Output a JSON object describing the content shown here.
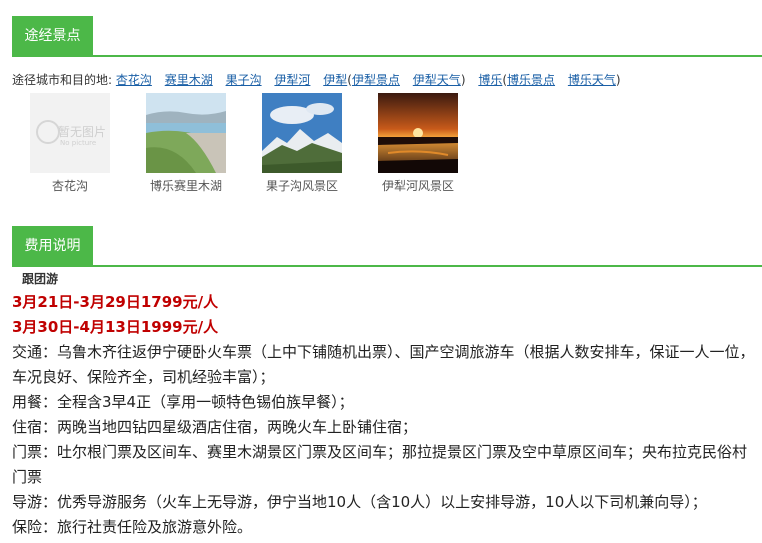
{
  "route_section": {
    "title": "途经景点",
    "label": "途径城市和目的地:",
    "links": [
      {
        "text": "杏花沟",
        "type": "city"
      },
      {
        "text": "赛里木湖",
        "type": "city"
      },
      {
        "text": "果子沟",
        "type": "city"
      },
      {
        "text": "伊犁河",
        "type": "city"
      },
      {
        "text": "伊犁",
        "type": "city"
      },
      {
        "text": "(",
        "type": "paren"
      },
      {
        "text": "伊犁景点",
        "type": "sub"
      },
      {
        "text": "伊犁天气",
        "type": "sub"
      },
      {
        "text": ")",
        "type": "paren"
      },
      {
        "text": "博乐",
        "type": "city"
      },
      {
        "text": "(",
        "type": "paren"
      },
      {
        "text": "博乐景点",
        "type": "sub"
      },
      {
        "text": "博乐天气",
        "type": "sub"
      },
      {
        "text": ")",
        "type": "paren"
      }
    ],
    "photos": [
      {
        "caption": "杏花沟",
        "placeholder_title": "暂无图片",
        "placeholder_sub": "No picture"
      },
      {
        "caption": "博乐赛里木湖"
      },
      {
        "caption": "果子沟风景区"
      },
      {
        "caption": "伊犁河风景区"
      }
    ]
  },
  "fee_section": {
    "title": "费用说明",
    "tour_type": "跟团游",
    "prices": [
      "3月21日-3月29日1799元/人",
      "3月30日-4月13日1999元/人"
    ],
    "details": [
      "交通：乌鲁木齐往返伊宁硬卧火车票（上中下铺随机出票）、国产空调旅游车（根据人数安排车，保证一人一位，车况良好、保险齐全，司机经验丰富）；",
      "用餐：全程含3早4正（享用一顿特色锡伯族早餐）；",
      "住宿：两晚当地四钻四星级酒店住宿，两晚火车上卧铺住宿；",
      "门票：吐尔根门票及区间车、赛里木湖景区门票及区间车；那拉提景区门票及空中草原区间车；央布拉克民俗村门票",
      "导游：优秀导游服务（火车上无导游，伊宁当地10人（含10人）以上安排导游，10人以下司机兼向导）；",
      "保险：旅行社责任险及旅游意外险。"
    ]
  },
  "colors": {
    "accent": "#4cb848",
    "link": "#1a5fa6",
    "price": "#c00000"
  }
}
